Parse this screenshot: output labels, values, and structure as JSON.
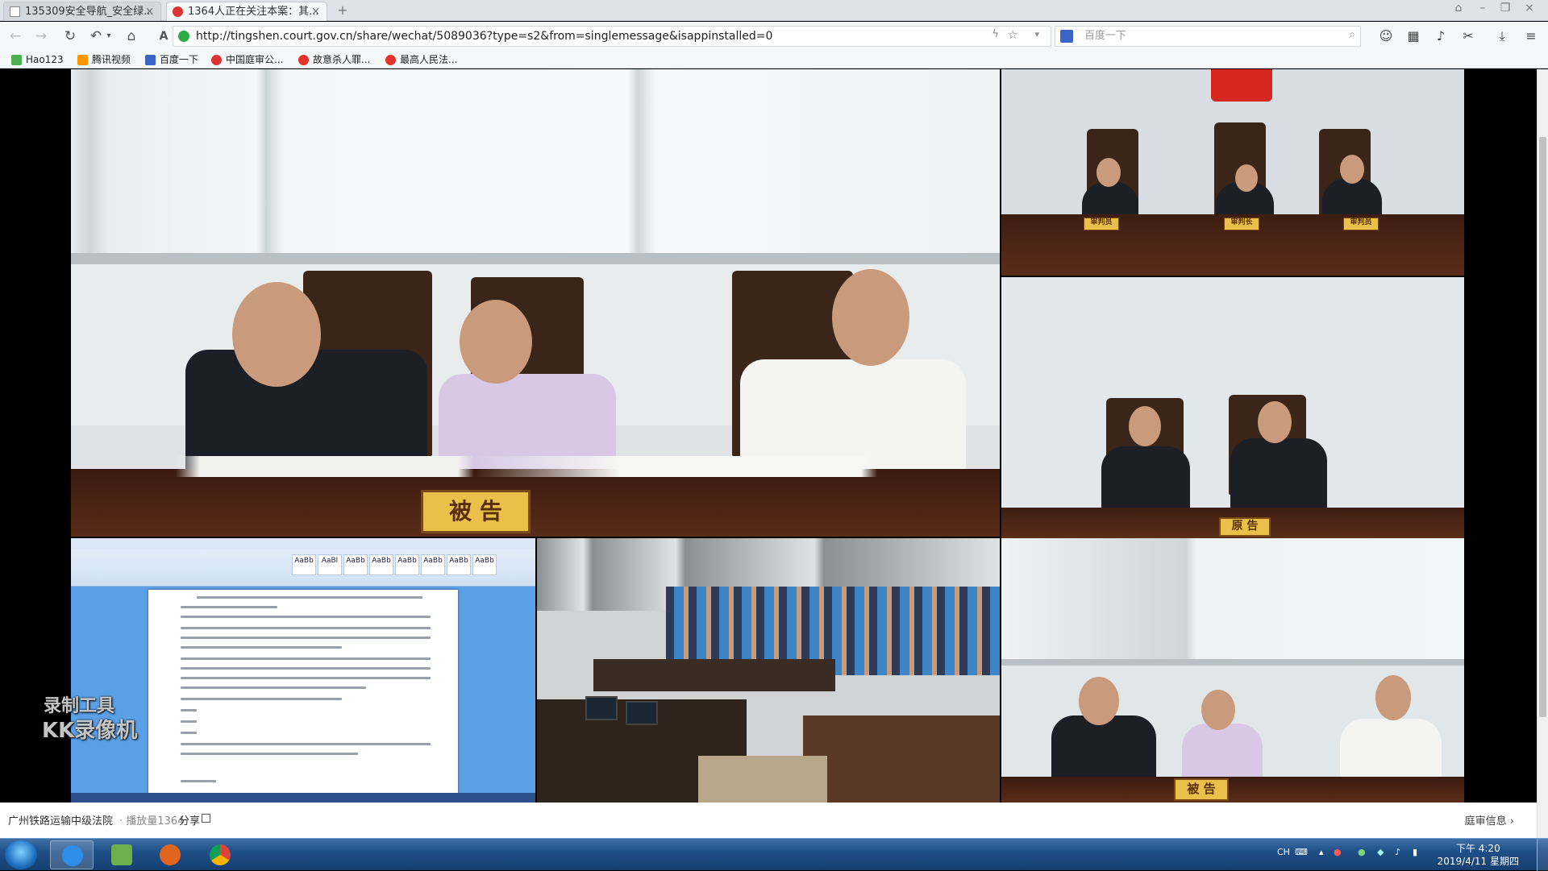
{
  "browser": {
    "tabs": [
      {
        "label": "135309安全导航_安全绿...",
        "active": false
      },
      {
        "label": "1364人正在关注本案：其...",
        "active": true
      }
    ],
    "url": "http://tingshen.court.gov.cn/share/wechat/5089036?type=s2&from=singlemessage&isappinstalled=0",
    "search_placeholder": "百度一下",
    "bookmarks": [
      "Hao123",
      "腾讯视频",
      "百度一下",
      "中国庭审公...",
      "故意杀人罪...",
      "最高人民法..."
    ]
  },
  "video": {
    "main_sign": "被 告",
    "plaintiff_sign": "原 告",
    "defendant_small_sign": "被 告",
    "judge_plates": [
      "审判员",
      "审判长",
      "审判员"
    ],
    "watermark": [
      "录制工具",
      "KK录像机"
    ]
  },
  "info": {
    "court_name": "广州铁路运输中级法院",
    "views": "· 播放量1364",
    "share": "分享",
    "court_info": "庭审信息 ›"
  },
  "taskbar": {
    "lang": "CH",
    "time": "下午 4:20",
    "date": "2019/4/11 星期四"
  },
  "colors": {
    "sign_yellow": "#e8c04a",
    "taskbar_blue": "#1e4f87",
    "desk_wood": "#4a2616"
  }
}
